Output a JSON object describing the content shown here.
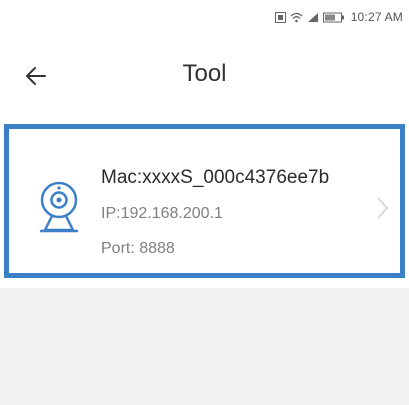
{
  "status_bar": {
    "time": "10:27 AM",
    "icons": [
      "sim-icon",
      "wifi-icon",
      "signal-icon",
      "battery-icon"
    ]
  },
  "header": {
    "title": "Tool",
    "back_icon": "back-arrow-icon"
  },
  "device": {
    "mac": "Mac:xxxxS_000c4376ee7b",
    "ip": "IP:192.168.200.1",
    "port": "Port: 8888",
    "icon": "webcam-icon"
  },
  "colors": {
    "accent": "#3b7fc6",
    "background": "#ffffff",
    "panel": "#f2f2f2"
  }
}
